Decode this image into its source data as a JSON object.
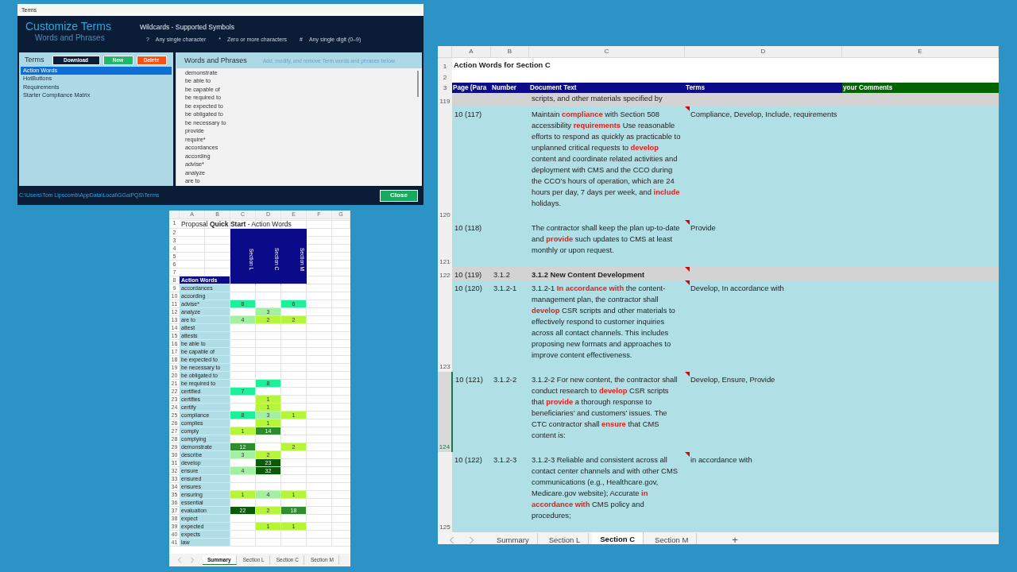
{
  "terms_dialog": {
    "title": "Terms",
    "heading": "Customize Terms",
    "subheading": "Words and Phrases",
    "wildcards_title": "Wildcards - Supported Symbols",
    "wildcards": [
      {
        "symbol": "?",
        "label": "Any single character"
      },
      {
        "symbol": "*",
        "label": "Zero or more characters"
      },
      {
        "symbol": "#",
        "label": "Any single digit (0–9)"
      }
    ],
    "terms_label": "Terms",
    "buttons": [
      {
        "label": "Download",
        "kind": "download"
      },
      {
        "label": "New",
        "kind": "new"
      },
      {
        "label": "Delete",
        "kind": "delete"
      }
    ],
    "term_list": [
      {
        "label": "Action Words",
        "selected": true
      },
      {
        "label": "HotButtons",
        "selected": false
      },
      {
        "label": "Requirements",
        "selected": false
      },
      {
        "label": "Starter Compliance Matrix",
        "selected": false
      }
    ],
    "words_title": "Words and Phrases",
    "words_hint": "Add, modify, and remove Term words and phrases below.",
    "words": [
      "demonstrate",
      "be able to",
      "be capable of",
      "be required to",
      "be expected to",
      "be obligated to",
      "be necessary to",
      "provide",
      "require*",
      "accordances",
      "according",
      "advise*",
      "analyze",
      "are to"
    ],
    "path": "C:\\Users\\Tom Lipscomb\\AppData\\Local\\GGaiPQS\\Terms",
    "close_button": "Close"
  },
  "summary_sheet": {
    "column_letters": [
      "A",
      "B",
      "C",
      "D",
      "E",
      "F",
      "G"
    ],
    "header_row_numbers": [
      "1",
      "2",
      "3",
      "4",
      "5",
      "6",
      "7",
      "8"
    ],
    "title": "Proposal **Quick Start** - Action Words",
    "section_headers": [
      "Section L",
      "Section C",
      "Section M"
    ],
    "list_heading": "Action Words",
    "rows": [
      {
        "number": "9",
        "word": "accordances",
        "cells": [
          null,
          null,
          null
        ]
      },
      {
        "number": "10",
        "word": "according",
        "cells": [
          null,
          null,
          null
        ]
      },
      {
        "number": "11",
        "word": "advise*",
        "cells": [
          {
            "value": "8",
            "color": "#1ef09a"
          },
          null,
          {
            "value": "6",
            "color": "#1ef09a"
          }
        ]
      },
      {
        "number": "12",
        "word": "analyze",
        "cells": [
          null,
          {
            "value": "3",
            "color": "#a2f0a0"
          },
          null
        ]
      },
      {
        "number": "13",
        "word": "are to",
        "cells": [
          {
            "value": "4",
            "color": "#a2f0a0"
          },
          {
            "value": "2",
            "color": "#b6f53a"
          },
          {
            "value": "2",
            "color": "#b6f53a"
          }
        ]
      },
      {
        "number": "14",
        "word": "attest",
        "cells": [
          null,
          null,
          null
        ]
      },
      {
        "number": "15",
        "word": "attests",
        "cells": [
          null,
          null,
          null
        ]
      },
      {
        "number": "16",
        "word": "be able to",
        "cells": [
          null,
          null,
          null
        ]
      },
      {
        "number": "17",
        "word": "be capable of",
        "cells": [
          null,
          null,
          null
        ]
      },
      {
        "number": "18",
        "word": "be expected to",
        "cells": [
          null,
          null,
          null
        ]
      },
      {
        "number": "19",
        "word": "be necessary to",
        "cells": [
          null,
          null,
          null
        ]
      },
      {
        "number": "20",
        "word": "be obligated to",
        "cells": [
          null,
          null,
          null
        ]
      },
      {
        "number": "21",
        "word": "be required to",
        "cells": [
          null,
          {
            "value": "8",
            "color": "#1ef09a"
          },
          null
        ]
      },
      {
        "number": "22",
        "word": "certified",
        "cells": [
          {
            "value": "7",
            "color": "#1ef09a"
          },
          null,
          null
        ]
      },
      {
        "number": "23",
        "word": "certifies",
        "cells": [
          null,
          {
            "value": "1",
            "color": "#b6f53a"
          },
          null
        ]
      },
      {
        "number": "24",
        "word": "certify",
        "cells": [
          null,
          {
            "value": "1",
            "color": "#b6f53a"
          },
          null
        ]
      },
      {
        "number": "25",
        "word": "compliance",
        "cells": [
          {
            "value": "8",
            "color": "#1ef09a"
          },
          {
            "value": "3",
            "color": "#a2f0a0"
          },
          {
            "value": "1",
            "color": "#b6f53a"
          }
        ]
      },
      {
        "number": "26",
        "word": "complies",
        "cells": [
          null,
          {
            "value": "1",
            "color": "#b6f53a"
          },
          null
        ]
      },
      {
        "number": "27",
        "word": "comply",
        "cells": [
          {
            "value": "1",
            "color": "#b6f53a"
          },
          {
            "value": "14",
            "color": "#2e8b2e"
          },
          null
        ]
      },
      {
        "number": "28",
        "word": "complying",
        "cells": [
          null,
          null,
          null
        ]
      },
      {
        "number": "29",
        "word": "demonstrate",
        "cells": [
          {
            "value": "12",
            "color": "#2e8b2e"
          },
          null,
          {
            "value": "2",
            "color": "#b6f53a"
          }
        ]
      },
      {
        "number": "30",
        "word": "describe",
        "cells": [
          {
            "value": "3",
            "color": "#a2f0a0"
          },
          {
            "value": "2",
            "color": "#b6f53a"
          },
          null
        ]
      },
      {
        "number": "31",
        "word": "develop",
        "cells": [
          null,
          {
            "value": "23",
            "color": "#0a5a0a"
          },
          null
        ]
      },
      {
        "number": "32",
        "word": "ensure",
        "cells": [
          {
            "value": "4",
            "color": "#a2f0a0"
          },
          {
            "value": "32",
            "color": "#0a5a0a"
          },
          null
        ]
      },
      {
        "number": "33",
        "word": "ensured",
        "cells": [
          null,
          null,
          null
        ]
      },
      {
        "number": "34",
        "word": "ensures",
        "cells": [
          null,
          null,
          null
        ]
      },
      {
        "number": "35",
        "word": "ensuring",
        "cells": [
          {
            "value": "1",
            "color": "#b6f53a"
          },
          {
            "value": "4",
            "color": "#a2f0a0"
          },
          {
            "value": "1",
            "color": "#b6f53a"
          }
        ]
      },
      {
        "number": "36",
        "word": "essential",
        "cells": [
          null,
          null,
          null
        ]
      },
      {
        "number": "37",
        "word": "evaluation",
        "cells": [
          {
            "value": "22",
            "color": "#0a5a0a"
          },
          {
            "value": "2",
            "color": "#b6f53a"
          },
          {
            "value": "18",
            "color": "#2e8b2e"
          }
        ]
      },
      {
        "number": "38",
        "word": "expect",
        "cells": [
          null,
          null,
          null
        ]
      },
      {
        "number": "39",
        "word": "expected",
        "cells": [
          null,
          {
            "value": "1",
            "color": "#b6f53a"
          },
          {
            "value": "1",
            "color": "#b6f53a"
          }
        ]
      },
      {
        "number": "40",
        "word": "expects",
        "cells": [
          null,
          null,
          null
        ]
      },
      {
        "number": "41",
        "word": "law",
        "cells": [
          null,
          null,
          null
        ]
      }
    ],
    "tabs": [
      {
        "label": "Summary",
        "selected": true
      },
      {
        "label": "Section L",
        "selected": false
      },
      {
        "label": "Section C",
        "selected": false
      },
      {
        "label": "Section M",
        "selected": false
      }
    ]
  },
  "section_sheet": {
    "column_letters": [
      "A",
      "B",
      "C",
      "D",
      "E"
    ],
    "header_row_numbers": [
      "1",
      "2",
      "3"
    ],
    "title": "Action Words for Section C",
    "headers": [
      {
        "label": "Page (Para",
        "kind": "navy"
      },
      {
        "label": "Number",
        "kind": "navy"
      },
      {
        "label": "Document Text",
        "kind": "navy"
      },
      {
        "label": "Terms",
        "kind": "navy"
      },
      {
        "label": "your Comments",
        "kind": "green"
      }
    ],
    "rows": [
      {
        "number": "119",
        "kind": "gray",
        "selected": false,
        "comment": false,
        "text": "scripts, and other materials specified by"
      },
      {
        "number": "120",
        "kind": "normal",
        "selected": false,
        "comment": true,
        "page": "10 (117)",
        "text": "Maintain **compliance** with Section 508 accessibility **requirements** Use reasonable efforts to respond as quickly as practicable to unplanned critical requests to **develop** content and coordinate related activities and deployment with CMS and the CCO during the CCO’s hours of operation, which are 24 hours per day, 7 days per week, and **include** holidays.",
        "terms": "Compliance, Develop, Include, requirements"
      },
      {
        "number": "121",
        "kind": "normal",
        "selected": false,
        "comment": true,
        "page": "10 (118)",
        "text": "The contractor shall keep the plan up-to-date and **provide** such updates to CMS at least monthly or upon request.",
        "terms": "Provide"
      },
      {
        "number": "122",
        "kind": "heading",
        "selected": false,
        "comment": true,
        "page": "10 (119)",
        "ref": "3.1.2",
        "text": "3.1.2 New Content Development"
      },
      {
        "number": "123",
        "kind": "normal",
        "selected": false,
        "comment": true,
        "page": "10 (120)",
        "ref": "3.1.2-1",
        "text": "3.1.2-1 **In accordance with** the content-management plan, the contractor shall **develop** CSR scripts and other materials to effectively respond to customer inquiries across all contact channels. This includes proposing new formats and approaches to improve content effectiveness.",
        "terms": "Develop, In accordance with"
      },
      {
        "number": "124",
        "kind": "normal",
        "selected": true,
        "comment": true,
        "page": "10 (121)",
        "ref": "3.1.2-2",
        "text": "3.1.2-2 For new content, the contractor shall conduct research to **develop** CSR scripts that **provide** a thorough response to beneficiaries’ and customers’ issues. The CTC contractor shall **ensure** that CMS content is:",
        "terms": "Develop, Ensure, Provide"
      },
      {
        "number": "125",
        "kind": "normal",
        "selected": false,
        "comment": true,
        "page": "10 (122)",
        "ref": "3.1.2-3",
        "text": "3.1.2-3 Reliable and consistent across all contact center channels and with other CMS communications (e.g., Healthcare.gov, Medicare.gov website); Accurate **in accordance with** CMS policy and procedures;",
        "terms": "in accordance with"
      }
    ],
    "tabs": [
      {
        "label": "Summary",
        "selected": false
      },
      {
        "label": "Section L",
        "selected": false
      },
      {
        "label": "Section C",
        "selected": true
      },
      {
        "label": "Section M",
        "selected": false
      }
    ],
    "add_tab": "+"
  }
}
